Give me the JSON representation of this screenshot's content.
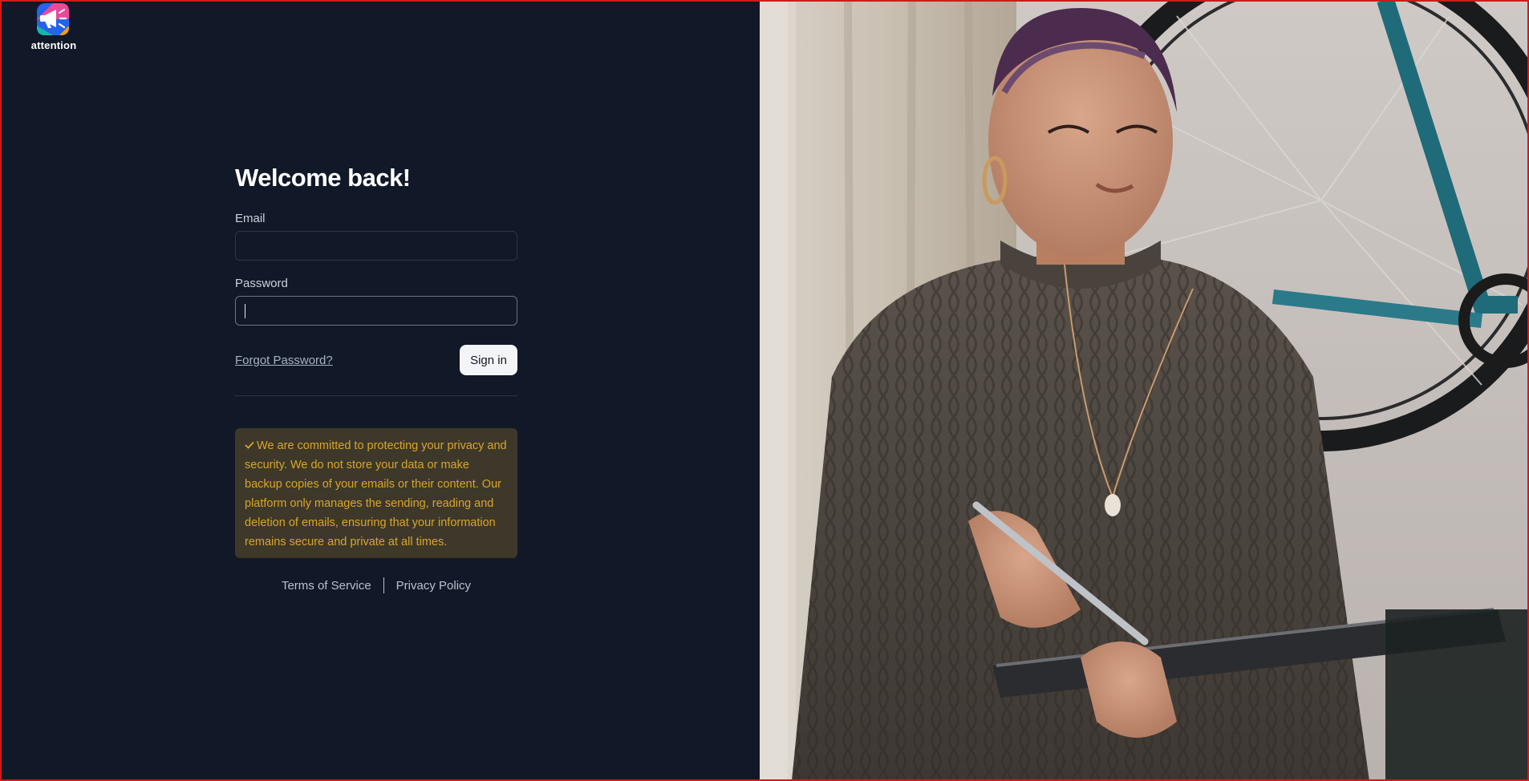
{
  "brand": {
    "name": "attention",
    "logo_icon": "megaphone-icon"
  },
  "form": {
    "title": "Welcome back!",
    "email_label": "Email",
    "email_value": "",
    "password_label": "Password",
    "password_value": "",
    "forgot_password": "Forgot Password?",
    "sign_in": "Sign in"
  },
  "notice": {
    "icon": "check-icon",
    "text": "We are committed to protecting your privacy and security. We do not store your data or make backup copies of your emails or their content. Our platform only manages the sending, reading and deletion of emails, ensuring that your information remains secure and private at all times."
  },
  "footer": {
    "terms": "Terms of Service",
    "privacy": "Privacy Policy"
  },
  "colors": {
    "background": "#111827",
    "notice_bg": "#3d3829",
    "notice_text": "#d9a52b",
    "button_bg": "#f3f4f6"
  }
}
